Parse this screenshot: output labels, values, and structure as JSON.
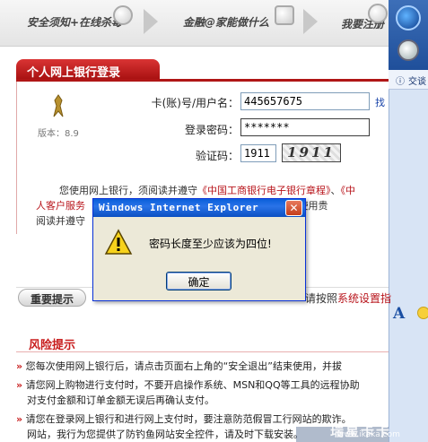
{
  "steps": [
    {
      "label": "安全须知+在线杀毒"
    },
    {
      "label": "金融@家能做什么"
    },
    {
      "label": "我要注册"
    }
  ],
  "side_panel": {
    "info_label": "交谈"
  },
  "login": {
    "title": "个人网上银行登录",
    "version": "版本：8.9",
    "card_label": "卡(账)号/用户名：",
    "card_value": "445657675",
    "password_label": "登录密码：",
    "password_value": "*******",
    "captcha_label": "验证码：",
    "captcha_value": "1911",
    "captcha_image_text": "1911",
    "forgot_link": "找"
  },
  "notice": {
    "line1_prefix": "您使用网上银行，须阅读并遵守",
    "line1_link": "《中国工商银行电子银行章程》",
    "line1_sep": "、",
    "line1_link2": "《中",
    "line2_text_a": "人客户服务",
    "line2_link": "则》",
    "line2_text_b": "，如您使用贵",
    "line3_text": "阅读并遵守"
  },
  "tip": {
    "button_label": "重要提示",
    "text_prefix": "请按照",
    "text_link": "系统设置指"
  },
  "risk": {
    "title": "风险提示",
    "items": [
      {
        "line1": "您每次使用网上银行后，请点击页面右上角的“安全退出”结束使用，并拔"
      },
      {
        "line1": "请您网上购物进行支付时，不要开启操作系统、MSN和QQ等工具的远程协助",
        "line2": "对支付金额和订单金额无误后再确认支付。"
      },
      {
        "line1": "请您在登录网上银行和进行网上支付时，要注意防范假冒工行网站的欺诈。",
        "line2": "网站，我行为您提供了防钓鱼网站安全控件，请及时下载安装。"
      }
    ]
  },
  "watermark": {
    "big": "瑞星卡卡",
    "small": "www.ikaka.com"
  },
  "dialog": {
    "title": "Windows Internet Explorer",
    "message": "密码长度至少应该为四位!",
    "ok_label": "确定"
  }
}
